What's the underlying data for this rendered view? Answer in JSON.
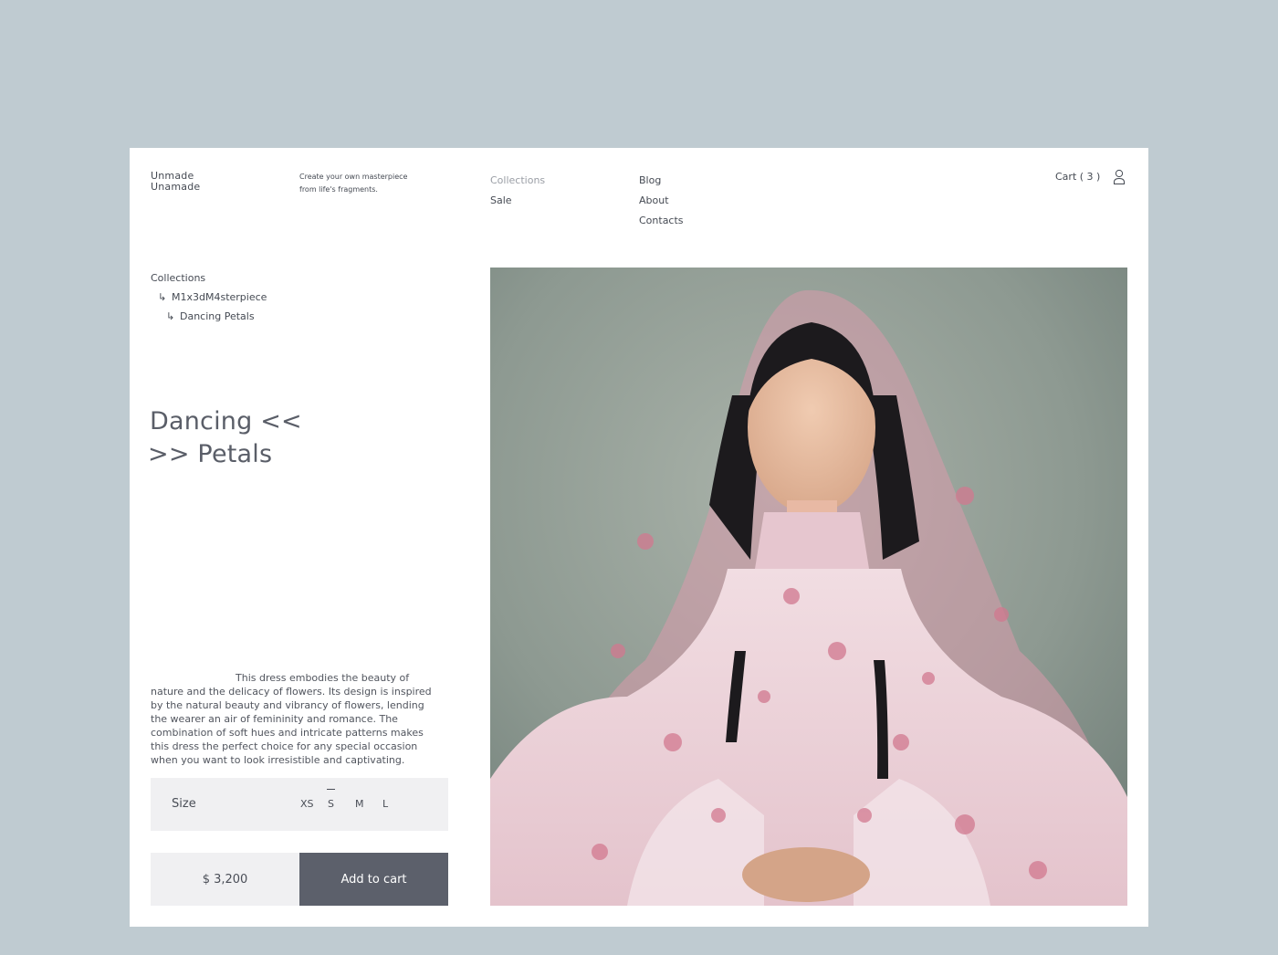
{
  "brand": {
    "line1": "Unmade",
    "line2": "Unamade"
  },
  "tagline": {
    "line1": "Create your own masterpiece",
    "line2": "from life's fragments."
  },
  "nav": {
    "col1": [
      {
        "label": "Collections"
      },
      {
        "label": "Sale"
      }
    ],
    "col2": [
      {
        "label": "Blog"
      },
      {
        "label": "About"
      },
      {
        "label": "Contacts"
      }
    ]
  },
  "cart": {
    "label": "Cart ( 3 )"
  },
  "icons": {
    "user": "user-icon",
    "arrow": "return-arrow-icon"
  },
  "breadcrumb": [
    {
      "label": "Collections"
    },
    {
      "label": "M1x3dM4sterpiece"
    },
    {
      "label": "Dancing Petals"
    }
  ],
  "product": {
    "title_line1": "Dancing <<",
    "title_line2": ">> Petals",
    "description": "This dress embodies the beauty of nature and the delicacy of flowers. Its design is inspired by the natural beauty and vibrancy of flowers, lending the wearer an air of femininity and romance. The combination of soft hues and intricate patterns makes this dress the perfect choice for any special occasion when you want to look irresistible and captivating.",
    "size_label": "Size",
    "sizes": [
      "XS",
      "S",
      "M",
      "L"
    ],
    "selected_size": "S",
    "price": "$ 3,200",
    "add_to_cart": "Add to cart"
  },
  "colors": {
    "background": "#bfcbd1",
    "card": "#ffffff",
    "button": "#5c606b",
    "panel": "#f0f0f2",
    "text": "#4a4e57"
  }
}
